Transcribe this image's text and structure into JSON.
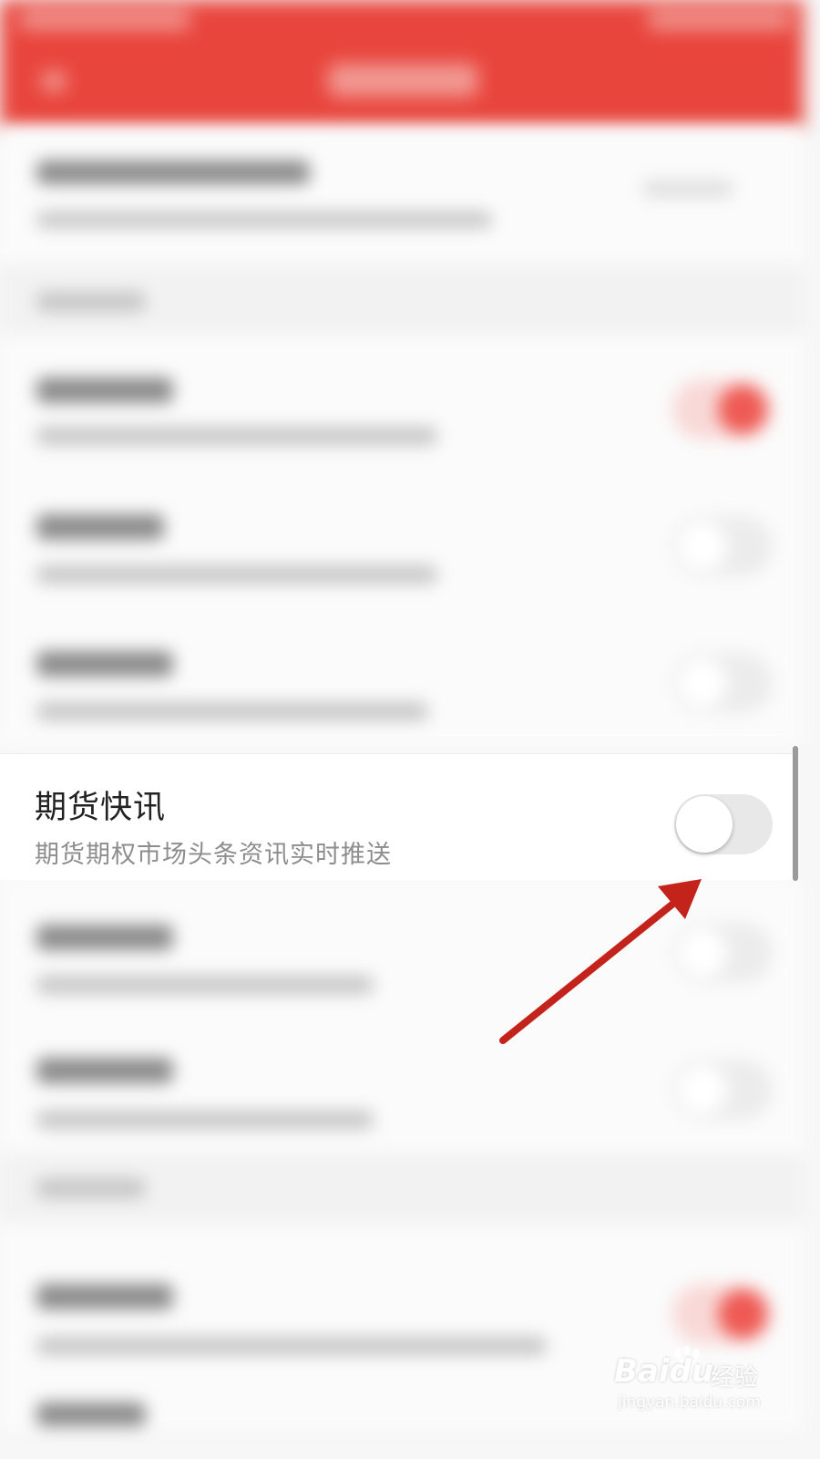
{
  "focused_setting": {
    "title": "期货快讯",
    "description": "期货期权市场头条资讯实时推送",
    "toggle_on": false
  },
  "watermark": {
    "logo": "Baidu",
    "cn_text": "经验",
    "url": "jingyan.baidu.com"
  },
  "colors": {
    "header": "#e8453c",
    "toggle_on": "#ef5a54",
    "annotation_arrow": "#c4231c"
  }
}
